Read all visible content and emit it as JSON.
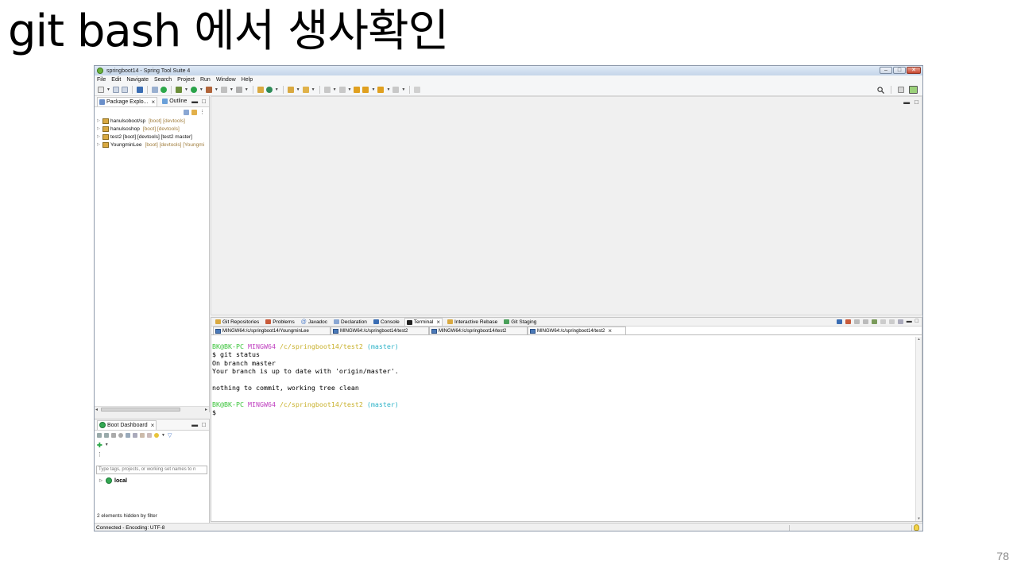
{
  "slide": {
    "title": "git bash 에서 생사확인",
    "page_number": "78"
  },
  "window": {
    "title": "springboot14 - Spring Tool Suite 4",
    "controls": [
      "‒",
      "□",
      "✕"
    ]
  },
  "menu": [
    "File",
    "Edit",
    "Navigate",
    "Search",
    "Project",
    "Run",
    "Window",
    "Help"
  ],
  "toolbar": {
    "icons": [
      "new-icon",
      "save-icon",
      "save-all-icon",
      "terminal-icon",
      "skip-breakpoints-icon",
      "debug-icon",
      "run-icon",
      "external-tools-icon",
      "stop-icon",
      "new-java-project-icon",
      "open-type-icon",
      "search-icon",
      "annotation-next-icon",
      "annotation-prev-icon",
      "back-icon",
      "forward-icon",
      "pin-editor-icon"
    ],
    "right_icons": [
      "quick-access-search-icon",
      "perspective-open-icon",
      "spring-perspective-icon"
    ]
  },
  "package_explorer": {
    "tabs": [
      {
        "label": "Package Explo...",
        "icon": "package-explorer-icon",
        "active": true
      },
      {
        "label": "Outline",
        "icon": "outline-icon",
        "active": false
      }
    ],
    "projects": [
      {
        "name": "hanulsoboot/sp",
        "deco": "[boot] [devtools]"
      },
      {
        "name": "hanulsoshop",
        "deco": "[boot] [devtools]"
      },
      {
        "name": "test2 [boot] [devtools] [test2 master]",
        "deco": ""
      },
      {
        "name": "YoungminLee",
        "deco": "[boot] [devtools] [Youngmi"
      }
    ]
  },
  "boot_dashboard": {
    "tab_label": "Boot Dashboard",
    "filter_placeholder": "Type tags, projects, or working set names to n",
    "local_label": "local",
    "hidden_note": "2 elements hidden by filter"
  },
  "bottom_panel": {
    "tabs": [
      {
        "label": "Git Repositories",
        "icon": "git-repositories-icon",
        "active": false
      },
      {
        "label": "Problems",
        "icon": "problems-icon",
        "active": false
      },
      {
        "label": "Javadoc",
        "icon": "javadoc-icon",
        "active": false
      },
      {
        "label": "Declaration",
        "icon": "declaration-icon",
        "active": false
      },
      {
        "label": "Console",
        "icon": "console-icon",
        "active": false
      },
      {
        "label": "Terminal",
        "icon": "terminal-icon",
        "active": true
      },
      {
        "label": "Interactive Rebase",
        "icon": "rebase-icon",
        "active": false
      },
      {
        "label": "Git Staging",
        "icon": "git-staging-icon",
        "active": false
      }
    ],
    "terminal_tabs": [
      {
        "label": "MINGW64:/c/springboot14/YoungminLee",
        "active": false
      },
      {
        "label": "MINGW64:/c/springboot14/test2",
        "active": false
      },
      {
        "label": "MINGW64:/c/springboot14/test2",
        "active": false
      },
      {
        "label": "MINGW64:/c/springboot14/test2",
        "active": true
      }
    ]
  },
  "terminal": {
    "prompt1": {
      "user": "BK@BK-PC",
      "ming": "MINGW64",
      "path": "/c/springboot14/test2",
      "branch": "(master)"
    },
    "lines": [
      "$ git status",
      "On branch master",
      "Your branch is up to date with 'origin/master'.",
      "",
      "nothing to commit, working tree clean"
    ],
    "prompt2": {
      "user": "BK@BK-PC",
      "ming": "MINGW64",
      "path": "/c/springboot14/test2",
      "branch": "(master)"
    },
    "cursor_line": "$"
  },
  "status_bar": {
    "text": "Connected - Encoding: UTF-8"
  },
  "colors": {
    "prompt_user": "#3cc43c",
    "prompt_ming": "#c040c0",
    "prompt_path": "#c8b02a",
    "prompt_branch": "#2db3c8"
  }
}
